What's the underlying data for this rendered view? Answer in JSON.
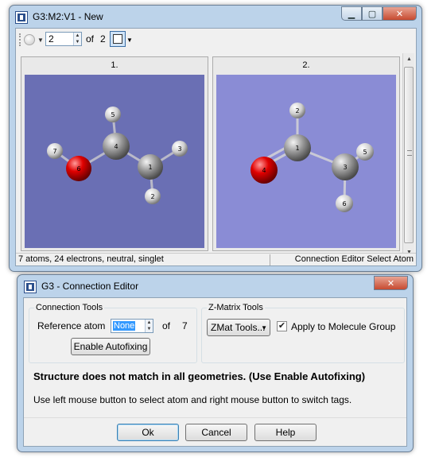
{
  "main_window": {
    "title": "G3:M2:V1 - New",
    "caption": {
      "minimize": "▁",
      "maximize": "▢",
      "close": "✕"
    },
    "toolbar": {
      "geometry_value": "2",
      "of_label": "of",
      "total": "2"
    },
    "panels": [
      {
        "label": "1.",
        "background": "#6a6fb4"
      },
      {
        "label": "2.",
        "background": "#8a8cd5"
      }
    ],
    "status": {
      "left": "7 atoms, 24 electrons, neutral, singlet",
      "right": "Connection Editor Select Atom"
    }
  },
  "molecule1": {
    "atoms": [
      {
        "id": "1",
        "element": "C"
      },
      {
        "id": "2",
        "element": "H"
      },
      {
        "id": "3",
        "element": "H"
      },
      {
        "id": "4",
        "element": "C"
      },
      {
        "id": "5",
        "element": "H"
      },
      {
        "id": "6",
        "element": "O"
      },
      {
        "id": "7",
        "element": "H"
      }
    ]
  },
  "molecule2": {
    "atoms": [
      {
        "id": "1",
        "element": "C"
      },
      {
        "id": "2",
        "element": "H"
      },
      {
        "id": "3",
        "element": "C"
      },
      {
        "id": "4",
        "element": "O"
      },
      {
        "id": "5",
        "element": "H"
      },
      {
        "id": "6",
        "element": "H"
      }
    ]
  },
  "editor": {
    "title": "G3 - Connection Editor",
    "close": "✕",
    "connection_tools": {
      "legend": "Connection Tools",
      "reference_label": "Reference atom",
      "reference_value": "None",
      "of_label": "of",
      "total": "7",
      "autofix_button": "Enable Autofixing"
    },
    "zmatrix_tools": {
      "legend": "Z-Matrix Tools",
      "zmat_button": "ZMat Tools...",
      "apply_checked": true,
      "apply_label": "Apply to Molecule Group"
    },
    "warning": "Structure does not match in all geometries.  (Use Enable Autofixing)",
    "hint": "Use left mouse button to select atom and right mouse button to switch tags.",
    "buttons": {
      "ok": "Ok",
      "cancel": "Cancel",
      "help": "Help"
    }
  }
}
